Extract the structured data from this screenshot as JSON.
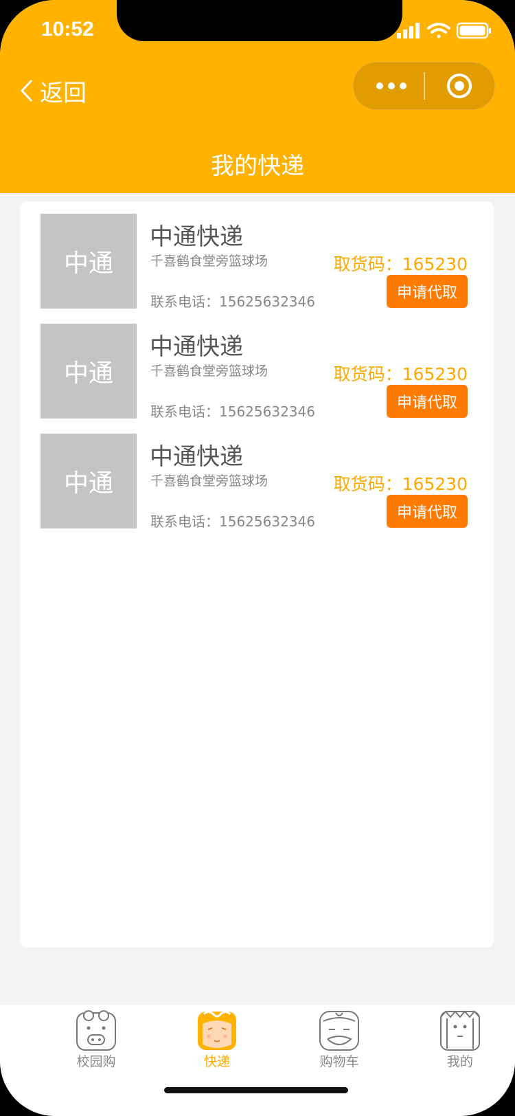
{
  "status": {
    "time": "10:52"
  },
  "nav": {
    "back_label": "返回",
    "title": "我的快递"
  },
  "colors": {
    "accent": "#ffb200",
    "button": "#ff7a00",
    "code": "#ffa800"
  },
  "items": [
    {
      "logo": "中通",
      "name": "中通快递",
      "address": "千喜鹤食堂旁篮球场",
      "code": "取货码：165230",
      "phone": "联系电话：15625632346",
      "button": "申请代取"
    },
    {
      "logo": "中通",
      "name": "中通快递",
      "address": "千喜鹤食堂旁篮球场",
      "code": "取货码：165230",
      "phone": "联系电话：15625632346",
      "button": "申请代取"
    },
    {
      "logo": "中通",
      "name": "中通快递",
      "address": "千喜鹤食堂旁篮球场",
      "code": "取货码：165230",
      "phone": "联系电话：15625632346",
      "button": "申请代取"
    }
  ],
  "tabbar": {
    "tabs": [
      {
        "label": "校园购",
        "icon": "pig-face-icon"
      },
      {
        "label": "快递",
        "icon": "monkey-face-icon",
        "active": true
      },
      {
        "label": "购物车",
        "icon": "monk-face-icon"
      },
      {
        "label": "我的",
        "icon": "sandy-face-icon"
      }
    ]
  }
}
